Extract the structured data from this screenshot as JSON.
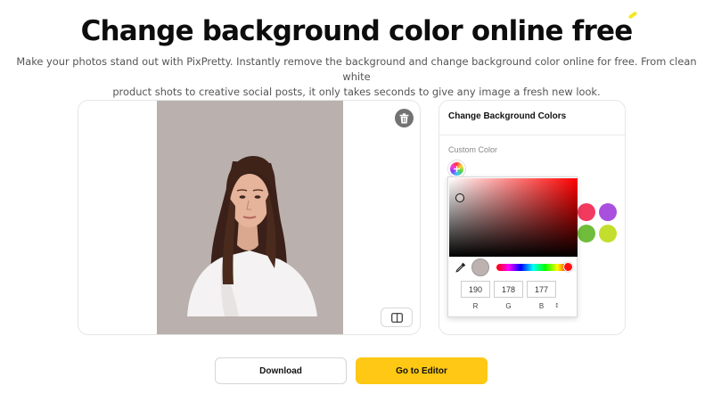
{
  "header": {
    "title_main": "Change background color online",
    "title_accent": "free",
    "subtitle_line1": "Make your photos stand out with PixPretty. Instantly remove the background and change background color online for free. From clean white",
    "subtitle_line2": "product shots to creative social posts, it only takes seconds to give any image a fresh new look."
  },
  "preview": {
    "background_color": "#bab0ad",
    "delete_icon": "trash-icon",
    "compare_icon": "compare-split-icon"
  },
  "panel": {
    "title": "Change Background Colors",
    "custom_label": "Custom Color",
    "custom_icon": "add-color-icon",
    "swatches": [
      {
        "name": "pink-red",
        "color": "#f23a5e"
      },
      {
        "name": "purple",
        "color": "#a94fdd"
      },
      {
        "name": "green",
        "color": "#6fbd3a"
      },
      {
        "name": "lime",
        "color": "#c4de2e"
      }
    ]
  },
  "color_picker": {
    "hue_color": "#ff0000",
    "preview_color": "#beb2b1",
    "eyedropper_icon": "eyedropper-icon",
    "r": "190",
    "g": "178",
    "b": "177",
    "r_label": "R",
    "g_label": "G",
    "b_label": "B",
    "mode_toggle": "↕"
  },
  "actions": {
    "download_label": "Download",
    "editor_label": "Go to Editor"
  },
  "colors": {
    "accent_yellow": "#fec814",
    "highlight": "#f6e71a"
  }
}
